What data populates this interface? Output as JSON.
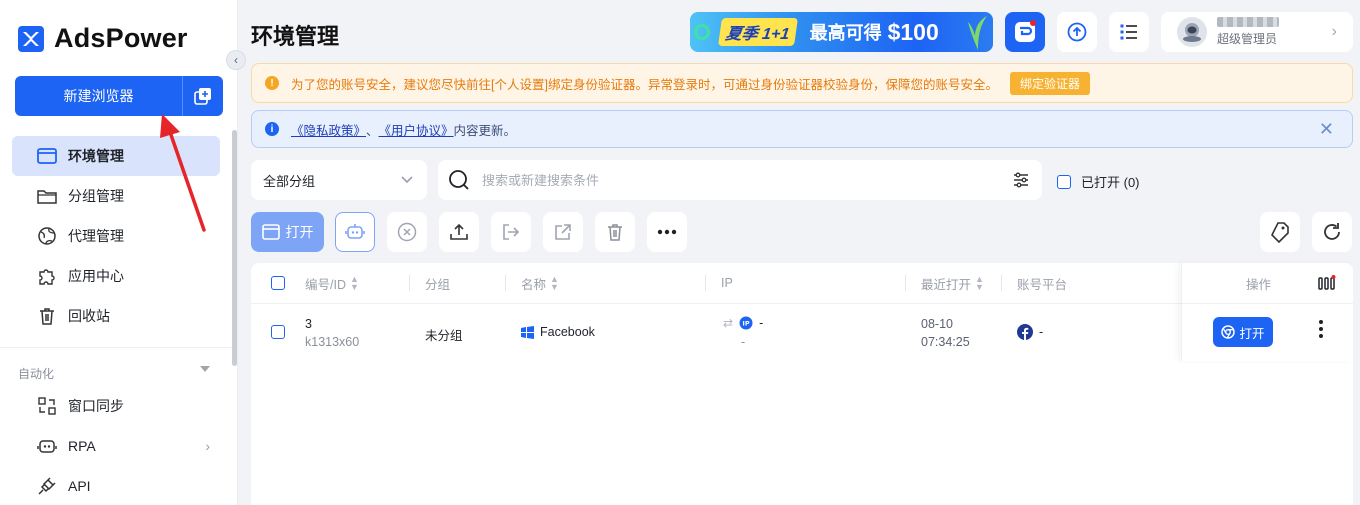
{
  "brand": {
    "name": "AdsPower"
  },
  "sidebar": {
    "new_browser_label": "新建浏览器",
    "items": [
      {
        "label": "环境管理",
        "icon": "browser-window-icon",
        "active": true
      },
      {
        "label": "分组管理",
        "icon": "folder-icon"
      },
      {
        "label": "代理管理",
        "icon": "globe-icon"
      },
      {
        "label": "应用中心",
        "icon": "puzzle-icon"
      },
      {
        "label": "回收站",
        "icon": "trash-icon"
      }
    ],
    "automation_title": "自动化",
    "automation_items": [
      {
        "label": "窗口同步",
        "icon": "window-sync-icon"
      },
      {
        "label": "RPA",
        "icon": "robot-icon"
      },
      {
        "label": "API",
        "icon": "plug-icon"
      }
    ]
  },
  "header": {
    "title": "环境管理",
    "promo": {
      "tag": "夏季 1+1",
      "text": "最高可得",
      "amount": "$100"
    },
    "user": {
      "role": "超级管理员"
    }
  },
  "alerts": {
    "warning": {
      "text": "为了您的账号安全，建议您尽快前往[个人设置]绑定身份验证器。异常登录时，可通过身份验证器校验身份，保障您的账号安全。",
      "button": "绑定验证器"
    },
    "info": {
      "link1": "《隐私政策》",
      "sep": "、",
      "link2": "《用户协议》",
      "suffix": "内容更新。"
    }
  },
  "filters": {
    "group_value": "全部分组",
    "search_placeholder": "搜索或新建搜索条件",
    "opened_label": "已打开 (0)"
  },
  "toolbar": {
    "open_label": "打开"
  },
  "table": {
    "columns": {
      "id": "编号/ID",
      "group": "分组",
      "name": "名称",
      "ip": "IP",
      "last_open": "最近打开",
      "platform": "账号平台",
      "ops": "操作"
    },
    "rows": [
      {
        "number": "3",
        "id": "k1313x60",
        "group": "未分组",
        "name": "Facebook",
        "ip": "-",
        "ip_sub": "-",
        "last_open_date": "08-10",
        "last_open_time": "07:34:25",
        "platform": "-",
        "open_label": "打开"
      }
    ]
  },
  "colors": {
    "primary": "#1d63f4",
    "warning": "#e57b0d",
    "warning_btn": "#f8b232",
    "info_bg": "#e8effd"
  }
}
